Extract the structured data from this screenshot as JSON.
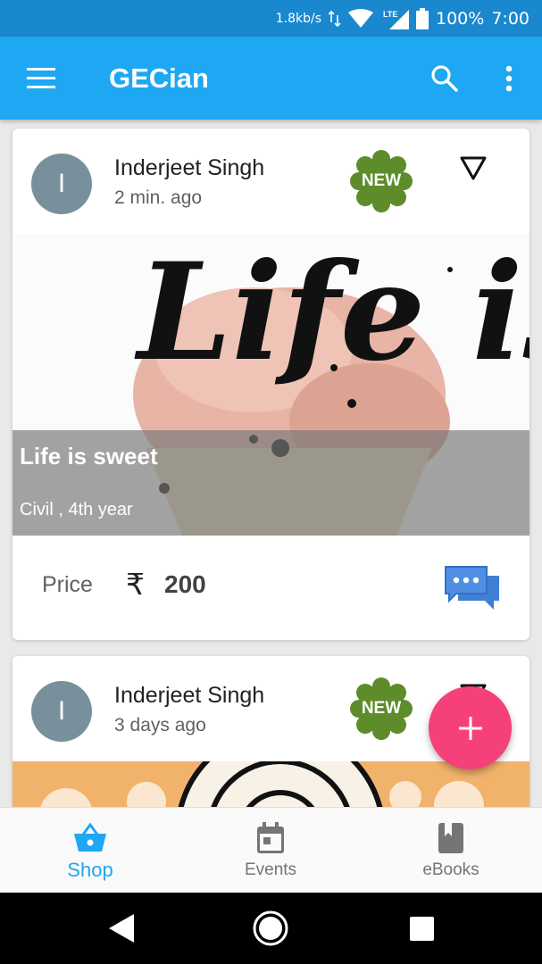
{
  "status_bar": {
    "speed": "1.8kb/s",
    "network": "LTE",
    "battery": "100%",
    "time": "7:00"
  },
  "app_bar": {
    "title": "GECian",
    "color": "#1ea7f2",
    "icons": [
      "menu-icon",
      "search-icon",
      "more-vert-icon"
    ]
  },
  "posts": [
    {
      "avatar_letter": "I",
      "author": "Inderjeet Singh",
      "time": "2 min. ago",
      "badge": "NEW",
      "image_text": "Life is sweet.",
      "title": "Life is sweet",
      "dept": "Civil , 4th year",
      "price_label": "Price",
      "currency": "₹",
      "price": "200"
    },
    {
      "avatar_letter": "I",
      "author": "Inderjeet Singh",
      "time": "3 days ago",
      "badge": "NEW"
    }
  ],
  "fab": {
    "icon": "plus-icon",
    "color": "#f5407a"
  },
  "bottom_nav": {
    "items": [
      {
        "label": "Shop",
        "icon": "basket-icon",
        "active": true
      },
      {
        "label": "Events",
        "icon": "calendar-icon",
        "active": false
      },
      {
        "label": "eBooks",
        "icon": "book-icon",
        "active": false
      }
    ]
  },
  "colors": {
    "primary": "#1ea7f2",
    "status_bar": "#1a88cf",
    "badge": "#5e8c2a",
    "accent": "#f5407a",
    "chat": "#3f7fd6"
  }
}
